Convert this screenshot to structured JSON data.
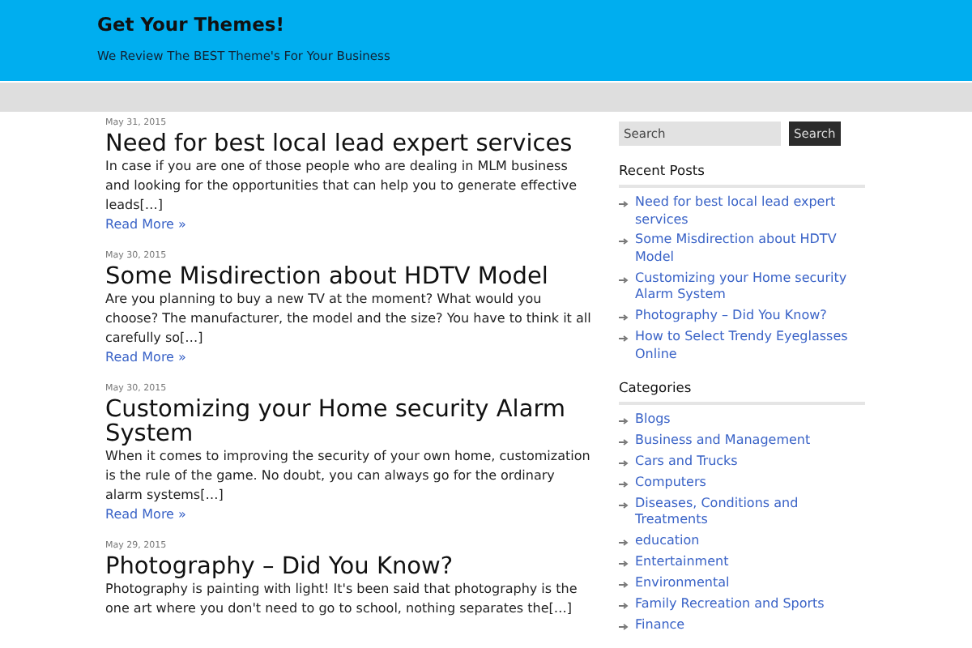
{
  "header": {
    "site_title": "Get Your Themes!",
    "tagline": "We Review The BEST Theme's For Your Business"
  },
  "posts": [
    {
      "date": "May 31, 2015",
      "title": "Need for best local lead expert services",
      "excerpt": "In case if you are one of those people who are dealing in MLM business and looking for the opportunities that can help you to generate effective leads[…]",
      "read_more": "Read More »"
    },
    {
      "date": "May 30, 2015",
      "title": "Some Misdirection about HDTV Model",
      "excerpt": "Are you planning to buy a new TV at the moment? What would you choose? The manufacturer, the model and the size? You have to think it all carefully so[…]",
      "read_more": "Read More »"
    },
    {
      "date": "May 30, 2015",
      "title": "Customizing your Home security Alarm System",
      "excerpt": "When it comes to improving the security of your own home, customization is the rule of the game. No doubt, you can always go for the ordinary alarm systems[…]",
      "read_more": "Read More »"
    },
    {
      "date": "May 29, 2015",
      "title": "Photography – Did You Know?",
      "excerpt": "Photography is painting with light! It's been said that photography is the one art where you don't need to go to school, nothing separates the[…]"
    }
  ],
  "sidebar": {
    "search": {
      "placeholder": "Search",
      "button": "Search"
    },
    "widgets": [
      {
        "title": "Recent Posts",
        "items": [
          "Need for best local lead expert services",
          "Some Misdirection about HDTV Model",
          "Customizing your Home security Alarm System",
          "Photography – Did You Know?",
          "How to Select Trendy Eyeglasses Online"
        ]
      },
      {
        "title": "Categories",
        "items": [
          "Blogs",
          "Business and Management",
          "Cars and Trucks",
          "Computers",
          "Diseases, Conditions and Treatments",
          "education",
          "Entertainment",
          "Environmental",
          "Family Recreation and Sports",
          "Finance"
        ]
      }
    ]
  }
}
